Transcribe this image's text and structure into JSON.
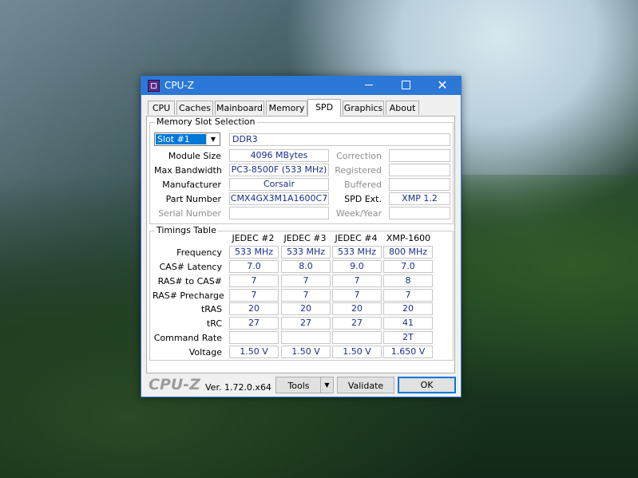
{
  "window": {
    "title": "CPU-Z",
    "controls": {
      "minimize": "minimize",
      "maximize": "maximize",
      "close": "✕"
    }
  },
  "tabs": [
    "CPU",
    "Caches",
    "Mainboard",
    "Memory",
    "SPD",
    "Graphics",
    "About"
  ],
  "active_tab": "SPD",
  "memory_slot": {
    "group_title": "Memory Slot Selection",
    "slot_selected": "Slot #1",
    "memory_type": "DDR3",
    "fields": {
      "module_size": {
        "label": "Module Size",
        "value": "4096 MBytes"
      },
      "max_bandwidth": {
        "label": "Max Bandwidth",
        "value": "PC3-8500F (533 MHz)"
      },
      "manufacturer": {
        "label": "Manufacturer",
        "value": "Corsair"
      },
      "part_number": {
        "label": "Part Number",
        "value": "CMX4GX3M1A1600C7"
      },
      "serial_number": {
        "label": "Serial Number",
        "value": ""
      },
      "correction": {
        "label": "Correction",
        "value": ""
      },
      "registered": {
        "label": "Registered",
        "value": ""
      },
      "buffered": {
        "label": "Buffered",
        "value": ""
      },
      "spd_ext": {
        "label": "SPD Ext.",
        "value": "XMP 1.2"
      },
      "week_year": {
        "label": "Week/Year",
        "value": ""
      }
    }
  },
  "timings": {
    "group_title": "Timings Table",
    "columns": [
      "JEDEC #2",
      "JEDEC #3",
      "JEDEC #4",
      "XMP-1600"
    ],
    "rows": [
      {
        "label": "Frequency",
        "values": [
          "533 MHz",
          "533 MHz",
          "533 MHz",
          "800 MHz"
        ]
      },
      {
        "label": "CAS# Latency",
        "values": [
          "7.0",
          "8.0",
          "9.0",
          "7.0"
        ]
      },
      {
        "label": "RAS# to CAS#",
        "values": [
          "7",
          "7",
          "7",
          "8"
        ]
      },
      {
        "label": "RAS# Precharge",
        "values": [
          "7",
          "7",
          "7",
          "7"
        ]
      },
      {
        "label": "tRAS",
        "values": [
          "20",
          "20",
          "20",
          "20"
        ]
      },
      {
        "label": "tRC",
        "values": [
          "27",
          "27",
          "27",
          "41"
        ]
      },
      {
        "label": "Command Rate",
        "values": [
          "",
          "",
          "",
          "2T"
        ]
      },
      {
        "label": "Voltage",
        "values": [
          "1.50 V",
          "1.50 V",
          "1.50 V",
          "1.650 V"
        ]
      }
    ]
  },
  "footer": {
    "logo": "CPU-Z",
    "version": "Ver. 1.72.0.x64",
    "tools_label": "Tools",
    "validate_label": "Validate",
    "ok_label": "OK"
  },
  "colors": {
    "titlebar": "#2b78d6",
    "value_text": "#1a2f8c",
    "selection": "#0078d7"
  },
  "icons": [
    "cpu-z-app-icon",
    "minimize-icon",
    "maximize-icon",
    "close-icon",
    "dropdown-arrow-icon"
  ]
}
